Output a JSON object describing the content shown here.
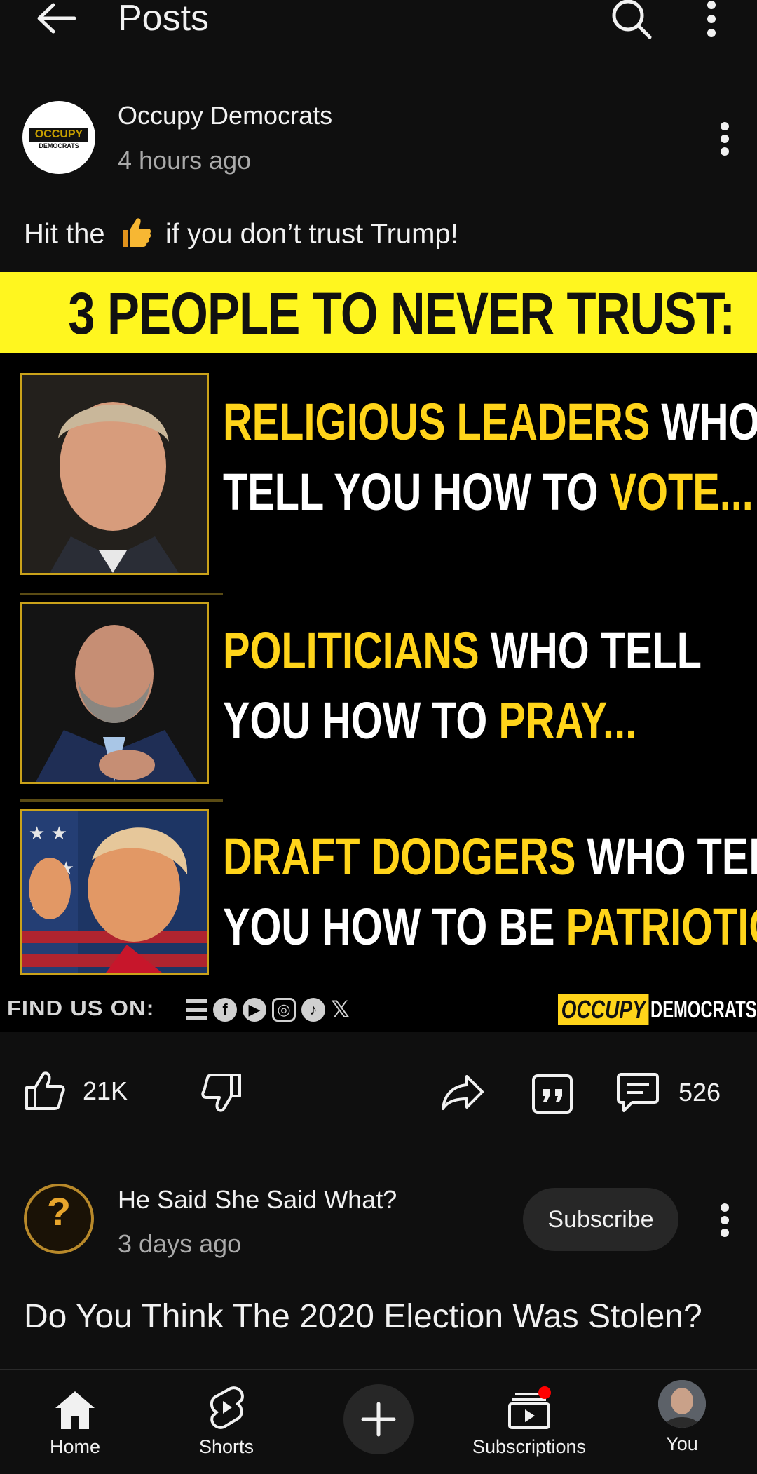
{
  "header": {
    "title": "Posts"
  },
  "post1": {
    "channel": "Occupy Democrats",
    "avatar_text": "OCCUPY",
    "avatar_subtext": "DEMOCRATS",
    "time": "4 hours ago",
    "text_before": "Hit the",
    "text_after": "if you don’t trust Trump!",
    "image": {
      "headline": "3 PEOPLE TO NEVER TRUST:",
      "items": [
        {
          "yellow1": "RELIGIOUS LEADERS",
          "white1": " WHO",
          "white2": "TELL YOU HOW TO ",
          "yellow2": "VOTE..."
        },
        {
          "yellow1": "POLITICIANS",
          "white1": " WHO TELL",
          "white2": "YOU HOW TO ",
          "yellow2": "PRAY..."
        },
        {
          "yellow1": "DRAFT DODGERS",
          "white1": " WHO TELL",
          "white2": "YOU HOW TO BE ",
          "yellow2": "PATRIOTIC..."
        }
      ],
      "find_us": "FIND US ON:",
      "brand_yellow": "OCCUPY",
      "brand_white": "DEMOCRATS"
    },
    "likes": "21K",
    "comments": "526"
  },
  "post2": {
    "channel": "He Said She Said What?",
    "time": "3 days ago",
    "subscribe_label": "Subscribe",
    "text": "Do You Think The 2020 Election Was Stolen?"
  },
  "nav": {
    "home": "Home",
    "shorts": "Shorts",
    "subscriptions": "Subscriptions",
    "you": "You"
  },
  "colors": {
    "background": "#0f0f0f",
    "accent_yellow": "#ffd41a",
    "headline_yellow": "#fff61f",
    "notification_red": "#ff0000"
  }
}
